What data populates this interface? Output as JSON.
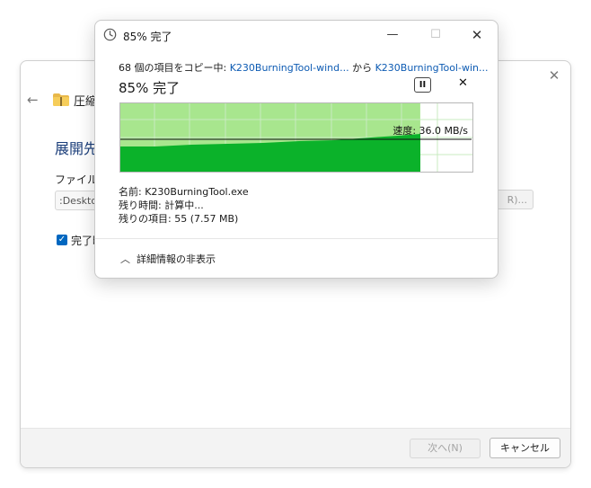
{
  "background_wizard": {
    "title": "圧縮",
    "heading": "展開先",
    "field_label": "ファイルを",
    "path_value": ":Desktop",
    "browse_label": "R)...",
    "checkbox_label": "完了時",
    "next_label": "次へ(N)",
    "cancel_label": "キャンセル"
  },
  "copy_dialog": {
    "window_title": "85% 完了",
    "copy_count_text": "68 個の項目をコピー中: ",
    "source_link": "K230BurningTool-wind...",
    "from_text": " から ",
    "dest_link": "K230BurningTool-win...",
    "percent_title": "85% 完了",
    "pause_label": "II",
    "cancel_label": "✕",
    "speed_label": "速度: 36.0 MB/s",
    "progress_fraction": 0.85,
    "info": {
      "name": "名前:  K230BurningTool.exe",
      "time_remaining": "残り時間:  計算中...",
      "items_remaining": "残りの項目:  55 (7.57 MB)"
    },
    "details_toggle_label": "詳細情報の非表示"
  },
  "colors": {
    "progress_fill": "#a8e68e",
    "speed_fill": "#0bb22a",
    "link": "#0d5bb3",
    "grid_line": "#c9ebc1"
  },
  "icons": {
    "title_icon": "clock-icon",
    "minimize": "minimize-icon",
    "maximize": "maximize-icon",
    "close": "close-icon",
    "details": "chevron-up-icon"
  }
}
